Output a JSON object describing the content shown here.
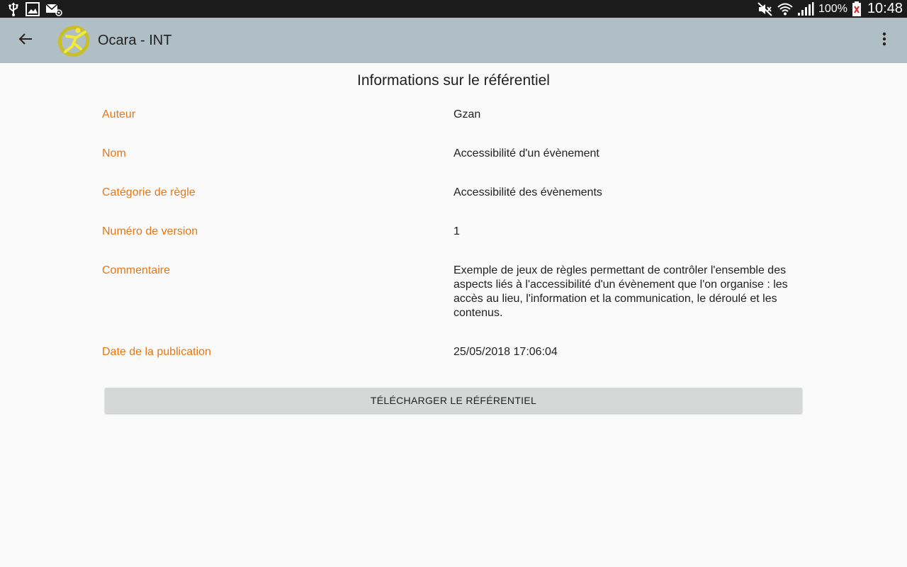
{
  "status_bar": {
    "left_icons": [
      "usb-icon",
      "image-icon",
      "email-notification-icon"
    ],
    "right_icons": [
      "mute-icon",
      "wifi-icon",
      "signal-icon",
      "battery-icon"
    ],
    "battery": "100%",
    "time": "10:48"
  },
  "app_bar": {
    "title": "Ocara - INT",
    "back_icon": "arrow-back-icon",
    "menu_icon": "more-vert-icon",
    "logo_icon": "ocara-logo",
    "color": "#b0bec5"
  },
  "page": {
    "heading": "Informations sur le référentiel"
  },
  "info": [
    {
      "label": "Auteur",
      "value": "Gzan"
    },
    {
      "label": "Nom",
      "value": "Accessibilité d'un évènement"
    },
    {
      "label": "Catégorie de règle",
      "value": "Accessibilité des évènements"
    },
    {
      "label": "Numéro de version",
      "value": "1"
    },
    {
      "label": "Commentaire",
      "value": "Exemple de jeux de règles permettant de contrôler l'ensemble des aspects liés à l'accessibilité d'un évènement que l'on organise : les accès au lieu, l'information et la communication, le déroulé et les contenus."
    },
    {
      "label": "Date de la publication",
      "value": "25/05/2018 17:06:04"
    }
  ],
  "actions": {
    "download_label": "TÉLÉCHARGER LE RÉFÉRENTIEL"
  },
  "colors": {
    "label": "#e87612",
    "background": "#fafafa",
    "button": "#d6d7d7"
  }
}
